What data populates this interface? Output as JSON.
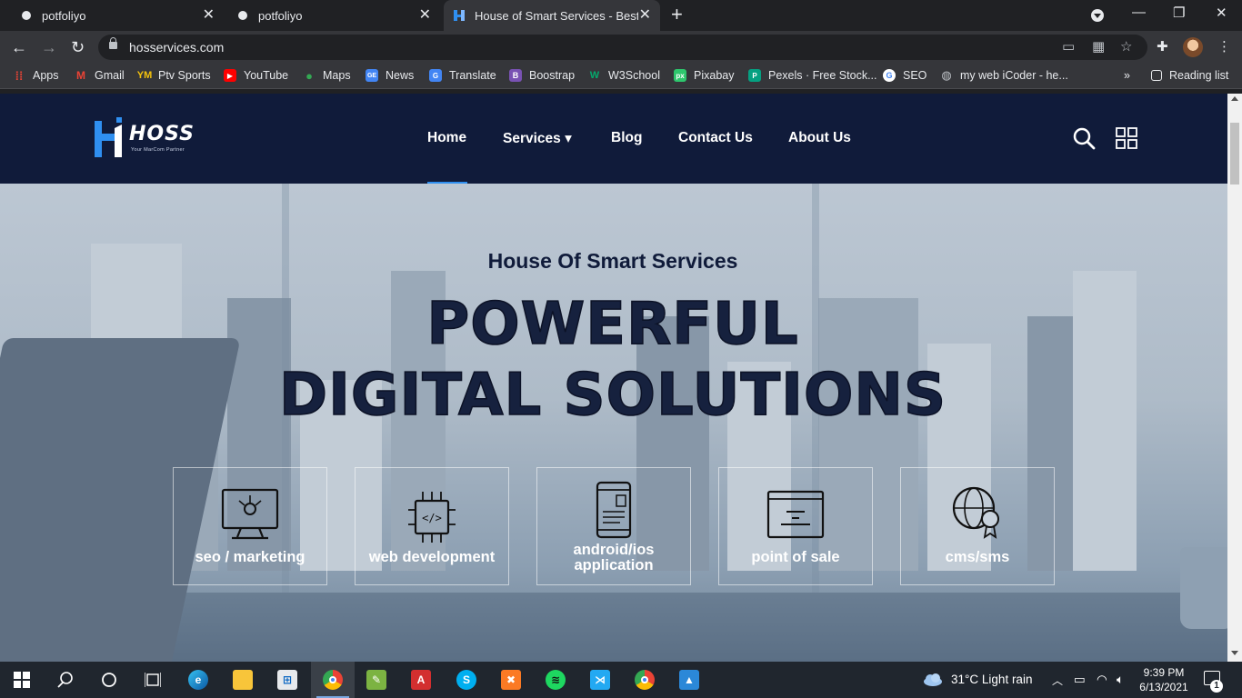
{
  "browser": {
    "tabs": [
      {
        "title": "potfoliyo",
        "active": false
      },
      {
        "title": "potfoliyo",
        "active": false
      },
      {
        "title": "House of Smart Services - Best So",
        "active": true
      }
    ],
    "url": "hosservices.com",
    "bookmarks": [
      {
        "label": "Apps",
        "icon": "apps-grid-icon",
        "color": "#ea4335"
      },
      {
        "label": "Gmail",
        "icon": "gmail-icon",
        "color": "#ea4335"
      },
      {
        "label": "Ptv Sports",
        "icon": "ptv-icon",
        "color": "#f4c20d"
      },
      {
        "label": "YouTube",
        "icon": "youtube-icon",
        "color": "#ff0000"
      },
      {
        "label": "Maps",
        "icon": "maps-icon",
        "color": "#34a853"
      },
      {
        "label": "News",
        "icon": "news-icon",
        "color": "#4285f4"
      },
      {
        "label": "Translate",
        "icon": "translate-icon",
        "color": "#4285f4"
      },
      {
        "label": "Boostrap",
        "icon": "bootstrap-icon",
        "color": "#7952b3"
      },
      {
        "label": "W3School",
        "icon": "w3school-icon",
        "color": "#04aa6d"
      },
      {
        "label": "Pixabay",
        "icon": "pixabay-icon",
        "color": "#2ec66d"
      },
      {
        "label": "Pexels · Free Stock...",
        "icon": "pexels-icon",
        "color": "#05a081"
      },
      {
        "label": "SEO",
        "icon": "google-icon",
        "color": "#ffffff"
      },
      {
        "label": "my web iCoder - he...",
        "icon": "globe-icon",
        "color": "#bdc1c6"
      }
    ],
    "reading_list": "Reading list",
    "more_bookmarks": "»"
  },
  "site": {
    "logo_text": "HOSS",
    "logo_tagline": "Your MarCom Partner",
    "nav": [
      {
        "label": "Home",
        "active": true
      },
      {
        "label": "Services ▾"
      },
      {
        "label": "Blog"
      },
      {
        "label": "Contact Us"
      },
      {
        "label": "About Us"
      }
    ],
    "hero": {
      "subtitle": "House Of Smart Services",
      "title_line1": "POWERFUL",
      "title_line2": "DIGITAL SOLUTIONS"
    },
    "services": [
      {
        "label": "seo / marketing",
        "icon": "seo-monitor-icon"
      },
      {
        "label": "web development",
        "icon": "web-dev-chip-icon"
      },
      {
        "label": "android/ios application",
        "icon": "mobile-app-icon"
      },
      {
        "label": "point of sale",
        "icon": "pos-terminal-icon"
      },
      {
        "label": "cms/sms",
        "icon": "cms-globe-badge-icon"
      }
    ],
    "accent": "#2f8ff0",
    "header_bg": "#101b3a"
  },
  "taskbar": {
    "weather": "31°C  Light rain",
    "time": "9:39 PM",
    "date": "6/13/2021",
    "notifications": "1"
  }
}
